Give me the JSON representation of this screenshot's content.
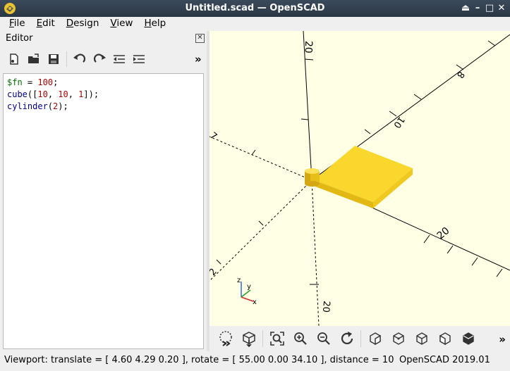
{
  "window": {
    "title": "Untitled.scad — OpenSCAD",
    "controls": [
      "up-icon",
      "minimize-icon",
      "maximize-icon",
      "close-icon"
    ]
  },
  "menu": [
    {
      "label": "File",
      "key": "F",
      "rest": "ile"
    },
    {
      "label": "Edit",
      "key": "E",
      "rest": "dit"
    },
    {
      "label": "Design",
      "key": "D",
      "rest": "esign"
    },
    {
      "label": "View",
      "key": "V",
      "rest": "iew"
    },
    {
      "label": "Help",
      "key": "H",
      "rest": "elp"
    }
  ],
  "editor": {
    "title": "Editor",
    "toolbar": [
      "new-file-icon",
      "open-file-icon",
      "save-icon",
      "undo-icon",
      "redo-icon",
      "unindent-icon",
      "indent-icon",
      "more-icon"
    ],
    "code": [
      {
        "parts": [
          {
            "t": "$fn",
            "c": "kw-var"
          },
          {
            "t": " = ",
            "c": ""
          },
          {
            "t": "100",
            "c": "num"
          },
          {
            "t": ";",
            "c": ""
          }
        ]
      },
      {
        "parts": [
          {
            "t": "cube",
            "c": "fn"
          },
          {
            "t": "([",
            "c": ""
          },
          {
            "t": "10",
            "c": "num"
          },
          {
            "t": ", ",
            "c": ""
          },
          {
            "t": "10",
            "c": "num"
          },
          {
            "t": ", ",
            "c": ""
          },
          {
            "t": "1",
            "c": "num"
          },
          {
            "t": "]);",
            "c": ""
          }
        ]
      },
      {
        "parts": [
          {
            "t": "cylinder",
            "c": "fn"
          },
          {
            "t": "(",
            "c": ""
          },
          {
            "t": "2",
            "c": "num"
          },
          {
            "t": ");",
            "c": ""
          }
        ]
      }
    ]
  },
  "viewport": {
    "background": "#ffffe5",
    "model_color": "#f9d72c",
    "axis_labels": {
      "z": "20",
      "x": "20",
      "y_pos": "10",
      "y_far": "8",
      "neg_z": "20",
      "neg_x": "7",
      "neg_x2": "2"
    },
    "axes_gizmo": {
      "x": "x",
      "y": "y",
      "z": "z"
    }
  },
  "view_toolbar": [
    "preview-icon",
    "render-icon",
    "view-all-icon",
    "zoom-in-icon",
    "zoom-out-icon",
    "reset-view-icon",
    "view-right-icon",
    "view-top-icon",
    "view-bottom-icon",
    "view-left-icon",
    "view-front-icon",
    "more-icon"
  ],
  "status": {
    "viewport": "Viewport: translate = [ 4.60 4.29 0.20 ], rotate = [ 55.00 0.00 34.10 ], distance = 10",
    "version": "OpenSCAD 2019.01"
  }
}
